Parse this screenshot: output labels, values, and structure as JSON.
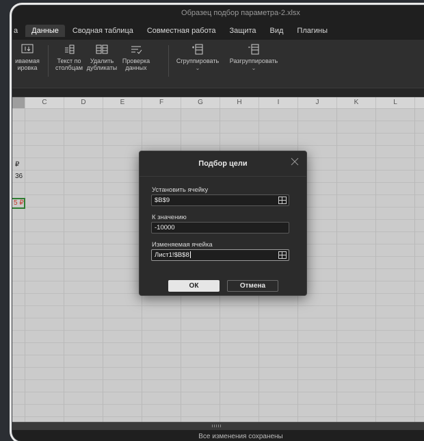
{
  "window": {
    "title": "Образец подбор параметра-2.xlsx"
  },
  "tabs": [
    {
      "label": "а",
      "active": false
    },
    {
      "label": "Данные",
      "active": true
    },
    {
      "label": "Сводная таблица",
      "active": false
    },
    {
      "label": "Совместная работа",
      "active": false
    },
    {
      "label": "Защита",
      "active": false
    },
    {
      "label": "Вид",
      "active": false
    },
    {
      "label": "Плагины",
      "active": false
    }
  ],
  "ribbon": {
    "group_partial": {
      "line1": "иваемая",
      "line2": "ировка"
    },
    "text_to_columns": {
      "line1": "Текст по",
      "line2": "столбцам"
    },
    "remove_duplicates": {
      "line1": "Удалить",
      "line2": "дубликаты"
    },
    "data_validation": {
      "line1": "Проверка",
      "line2": "данных"
    },
    "group": {
      "line1": "Сгруппировать",
      "chev": "⌄"
    },
    "ungroup": {
      "line1": "Разгруппировать",
      "chev": "⌄"
    }
  },
  "columns": [
    "C",
    "D",
    "E",
    "F",
    "G",
    "H",
    "I",
    "J",
    "K",
    "L"
  ],
  "cells": {
    "r1": "₽",
    "r2": "36",
    "r3": "5 ₽"
  },
  "dialog": {
    "title": "Подбор цели",
    "set_cell_label": "Установить ячейку",
    "set_cell_value": "$B$9",
    "to_value_label": "К значению",
    "to_value_value": "-10000",
    "changing_cell_label": "Изменяемая ячейка",
    "changing_cell_value": "Лист1!$B$8",
    "ok_label": "ОК",
    "cancel_label": "Отмена"
  },
  "status": {
    "text": "Все изменения сохранены"
  },
  "colors": {
    "active_cell_border": "#2e7d32",
    "currency_red": "#c0392b"
  }
}
